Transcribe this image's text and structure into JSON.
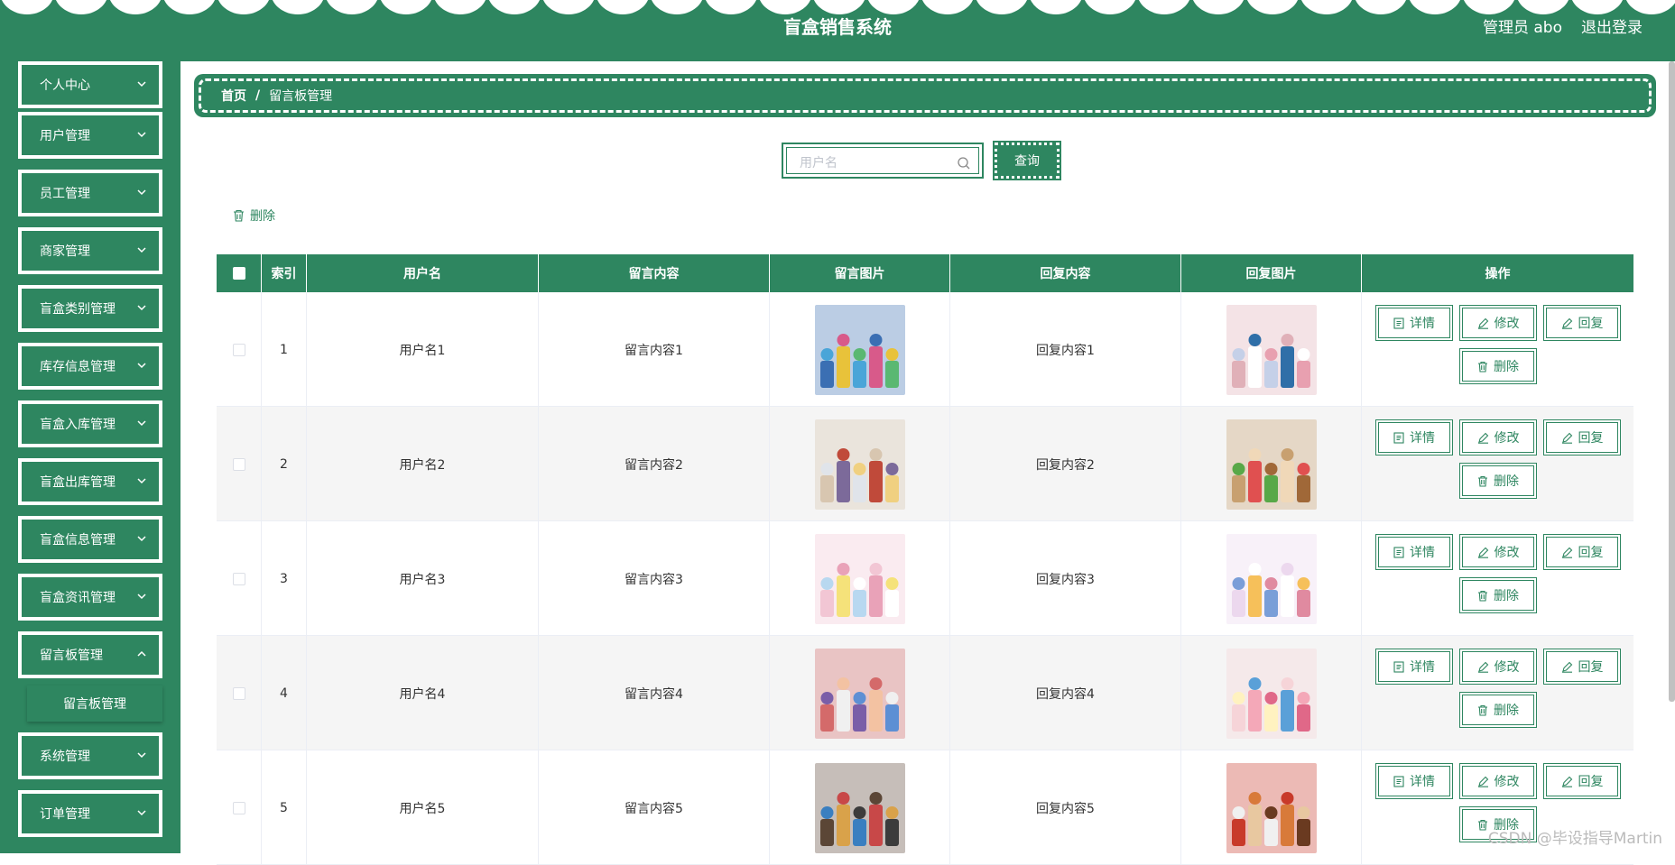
{
  "app": {
    "title": "盲盒销售系统",
    "user": "管理员 abo",
    "logout": "退出登录"
  },
  "colors": {
    "primary": "#2e8660"
  },
  "sidebar": {
    "items": [
      {
        "label": "个人中心"
      },
      {
        "label": "用户管理"
      },
      {
        "label": "员工管理"
      },
      {
        "label": "商家管理"
      },
      {
        "label": "盲盒类别管理"
      },
      {
        "label": "库存信息管理"
      },
      {
        "label": "盲盒入库管理"
      },
      {
        "label": "盲盒出库管理"
      },
      {
        "label": "盲盒信息管理"
      },
      {
        "label": "盲盒资讯管理"
      },
      {
        "label": "留言板管理"
      },
      {
        "label": "系统管理"
      },
      {
        "label": "订单管理"
      }
    ],
    "submenu": {
      "label": "留言板管理"
    }
  },
  "breadcrumb": {
    "home": "首页",
    "separator": "/",
    "current": "留言板管理"
  },
  "search": {
    "placeholder": "用户名",
    "value": "",
    "button": "查询"
  },
  "toolbar": {
    "delete": "删除"
  },
  "table": {
    "headers": [
      "索引",
      "用户名",
      "留言内容",
      "留言图片",
      "回复内容",
      "回复图片",
      "操作"
    ],
    "actions": {
      "detail": "详情",
      "edit": "修改",
      "reply": "回复",
      "delete": "删除"
    },
    "rows": [
      {
        "index": "1",
        "username": "用户名1",
        "message": "留言内容1",
        "reply": "回复内容1"
      },
      {
        "index": "2",
        "username": "用户名2",
        "message": "留言内容2",
        "reply": "回复内容2"
      },
      {
        "index": "3",
        "username": "用户名3",
        "message": "留言内容3",
        "reply": "回复内容3"
      },
      {
        "index": "4",
        "username": "用户名4",
        "message": "留言内容4",
        "reply": "回复内容4"
      },
      {
        "index": "5",
        "username": "用户名5",
        "message": "留言内容5",
        "reply": "回复内容5"
      }
    ]
  },
  "watermark": "CSDN @毕设指导Martin"
}
